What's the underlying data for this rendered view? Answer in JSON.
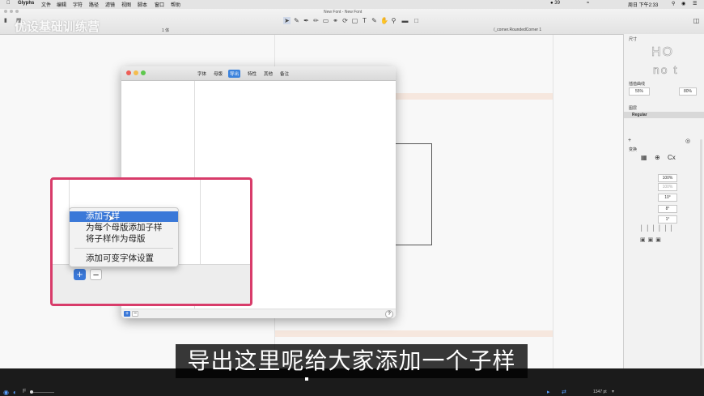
{
  "menubar": {
    "app": "Glyphs",
    "items": [
      "文件",
      "编辑",
      "字符",
      "路径",
      "滤镜",
      "视图",
      "脚本",
      "窗口",
      "帮助"
    ],
    "battery": "39",
    "clock": "周日 下午2:33"
  },
  "window": {
    "title": "New Font - New Font"
  },
  "watermark": "优设基础训练营",
  "toolbar": {
    "tab_left": "1 体",
    "tab_right": "/_corner.RoundedCorner 1"
  },
  "right_panel": {
    "size_header": "尺寸",
    "preview_text_top": "HO",
    "preview_text_bottom": "no t",
    "interp_header": "插值曲线",
    "interp_left": "55%",
    "interp_right": "80%",
    "layers_header": "图层",
    "layer_selected": "Regular",
    "transform_header": "变换",
    "scale_1": "100%",
    "scale_2": "100%",
    "rotate": "10°",
    "skew_1": "8°",
    "skew_2": "1°"
  },
  "dialog": {
    "tabs": [
      "字体",
      "母版",
      "导出",
      "特性",
      "其他",
      "备注"
    ],
    "active_tab": "导出",
    "help": "?"
  },
  "context_menu": {
    "items": [
      "添加子样",
      "为每个母版添加子样",
      "将子样作为母版",
      "添加可变字体设置"
    ],
    "selected": "添加子样"
  },
  "zoom_buttons": {
    "add": "+",
    "remove": "−"
  },
  "status": {
    "zoom": "1347 pt"
  },
  "subtitle": "导出这里呢给大家添加一个子样",
  "colors": {
    "highlight_border": "#d83c6a",
    "selection": "#3a78d8",
    "subtitle_bg": "#000000"
  }
}
